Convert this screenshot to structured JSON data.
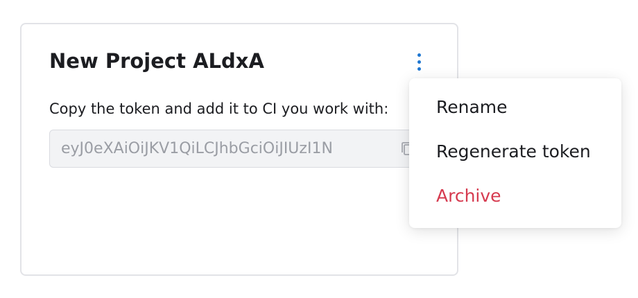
{
  "card": {
    "title": "New Project ALdxA",
    "instructions": "Copy the token and add it to CI you work with:",
    "token_value": "eyJ0eXAiOiJKV1QiLCJhbGciOiJIUzI1N"
  },
  "icons": {
    "menu_trigger": "more-vertical-icon",
    "copy": "copy-icon"
  },
  "menu": {
    "items": [
      {
        "label": "Rename"
      },
      {
        "label": "Regenerate token"
      },
      {
        "label": "Archive"
      }
    ]
  },
  "colors": {
    "accent": "#1f77d1",
    "danger": "#d63a4f",
    "muted_text": "#9a9da4",
    "border": "#e2e3e7"
  }
}
